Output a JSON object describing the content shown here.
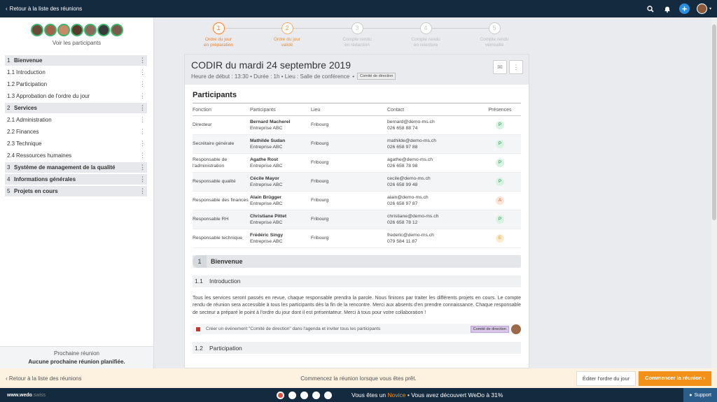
{
  "topbar": {
    "back_label": "Retour à la liste des réunions"
  },
  "sidebar": {
    "avatar_colors": [
      "#6b4a3a",
      "#a0644a",
      "#c98a6a",
      "#5a3a2a",
      "#8a6a5a",
      "#3a3a3a",
      "#7a5a4a"
    ],
    "see_participants": "Voir les participants",
    "agenda": [
      {
        "num": "1",
        "label": "Bienvenue",
        "section": true
      },
      {
        "num": "1.1",
        "label": "Introduction",
        "section": false
      },
      {
        "num": "1.2",
        "label": "Participation",
        "section": false
      },
      {
        "num": "1.3",
        "label": "Approbation de l'ordre du jour",
        "section": false
      },
      {
        "num": "2",
        "label": "Services",
        "section": true
      },
      {
        "num": "2.1",
        "label": "Administration",
        "section": false
      },
      {
        "num": "2.2",
        "label": "Finances",
        "section": false
      },
      {
        "num": "2.3",
        "label": "Technique",
        "section": false
      },
      {
        "num": "2.4",
        "label": "Ressources humaines",
        "section": false
      },
      {
        "num": "3",
        "label": "Système de management de la qualité",
        "section": true
      },
      {
        "num": "4",
        "label": "Informations générales",
        "section": true
      },
      {
        "num": "5",
        "label": "Projets en cours",
        "section": true
      }
    ],
    "next_meeting_title": "Prochaine réunion",
    "next_meeting_value": "Aucune prochaine réunion planifiée."
  },
  "stepper": [
    {
      "num": "1",
      "l1": "Ordre du jour",
      "l2": "en préparation",
      "state": "done"
    },
    {
      "num": "2",
      "l1": "Ordre du jour",
      "l2": "validé",
      "state": "active"
    },
    {
      "num": "3",
      "l1": "Compte rendu",
      "l2": "en rédaction",
      "state": "todo"
    },
    {
      "num": "4",
      "l1": "Compte rendu",
      "l2": "en relecture",
      "state": "todo"
    },
    {
      "num": "5",
      "l1": "Compte rendu",
      "l2": "verrouillé",
      "state": "todo"
    }
  ],
  "meeting": {
    "title": "CODIR du mardi 24 septembre 2019",
    "meta": "Heure de début : 13:30 • Durée : 1h • Lieu : Salle de conférence",
    "meta_sep": "•",
    "tag": "Comité de direction"
  },
  "participants": {
    "title": "Participants",
    "headers": {
      "fonction": "Fonction",
      "participants": "Participants",
      "lieu": "Lieu",
      "contact": "Contact",
      "presences": "Présences"
    },
    "rows": [
      {
        "fonction": "Directeur",
        "name": "Bernard Macherel",
        "company": "Entreprise ABC",
        "lieu": "Fribourg",
        "email": "bernard@demo-ms.ch",
        "phone": "026 658 88 74",
        "presence": "P"
      },
      {
        "fonction": "Secrétaire générale",
        "name": "Mathilde Sudan",
        "company": "Entreprise ABC",
        "lieu": "Fribourg",
        "email": "mathilde@demo-ms.ch",
        "phone": "026 658 97 88",
        "presence": "P"
      },
      {
        "fonction": "Responsable de l'administration",
        "name": "Agathe Rost",
        "company": "Entreprise ABC",
        "lieu": "Fribourg",
        "email": "agathe@demo-ms.ch",
        "phone": "026 658 78 98",
        "presence": "P"
      },
      {
        "fonction": "Responsable qualité",
        "name": "Cécile Mayor",
        "company": "Entreprise ABC",
        "lieu": "Fribourg",
        "email": "cecile@demo-ms.ch",
        "phone": "026 658 99 48",
        "presence": "P"
      },
      {
        "fonction": "Responsable des finances",
        "name": "Alain Brügger",
        "company": "Entreprise ABC",
        "lieu": "Fribourg",
        "email": "alain@demo-ms.ch",
        "phone": "026 658 97 87",
        "presence": "A"
      },
      {
        "fonction": "Responsable RH",
        "name": "Christiane Pittet",
        "company": "Entreprise ABC",
        "lieu": "Fribourg",
        "email": "christiane@demo-ms.ch",
        "phone": "026 658 78 12",
        "presence": "P"
      },
      {
        "fonction": "Responsable technique",
        "name": "Frédéric Singy",
        "company": "Entreprise ABC",
        "lieu": "Fribourg",
        "email": "frederic@demo-ms.ch",
        "phone": "079 584 11 87",
        "presence": "E"
      }
    ]
  },
  "section1": {
    "num": "1",
    "label": "Bienvenue"
  },
  "sub11": {
    "num": "1.1",
    "label": "Introduction"
  },
  "intro_text": "Tous les services seront passés en revue, chaque responsable prendra la parole. Nous finirons par traiter les différents projets en cours. Le compte rendu de réunion sera accessible à tous les participants dès la fin de la rencontre. Merci aux absents d'en prendre connaissance. Chaque responsable de secteur a préparé le point à l'ordre du jour dont il est présentateur. Merci à tous pour votre collaboration !",
  "task": {
    "text": "Créer un événement \"Comité de direction\" dans l'agenda et inviter tous les participants",
    "tag": "Comité de direction"
  },
  "sub12": {
    "num": "1.2",
    "label": "Participation"
  },
  "actionbar": {
    "back_label": "Retour à la liste des réunions",
    "message": "Commencez la réunion lorsque vous êtes prêt.",
    "edit_label": "Éditer l'ordre du jour",
    "start_label": "Commencer la réunion ›"
  },
  "footer": {
    "brand": "www.wedo",
    "brand_suffix": ".swiss",
    "msg_pre": "Vous êtes un",
    "msg_level": "Novice",
    "msg_post": "• Vous avez découvert WeDo à 31%",
    "support": "Support"
  }
}
